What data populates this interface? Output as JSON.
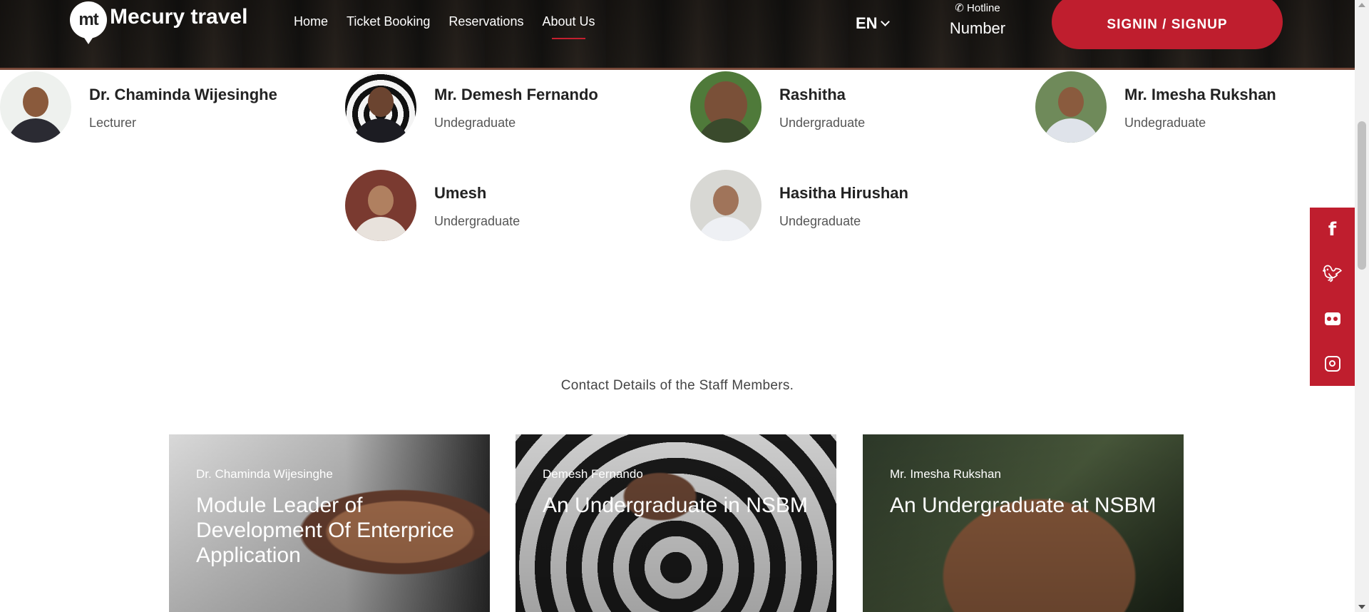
{
  "header": {
    "logo_mark": "mt",
    "logo_text": "Mecury travel",
    "nav": [
      {
        "label": "Home",
        "active": false
      },
      {
        "label": "Ticket Booking",
        "active": false
      },
      {
        "label": "Reservations",
        "active": false
      },
      {
        "label": "About Us",
        "active": true
      }
    ],
    "language": "EN",
    "hotline_icon": "phone-icon",
    "hotline_label": "Hotline",
    "hotline_number": "Number",
    "signin_label": "SIGNIN / SIGNUP",
    "accent_color": "#bf1e2e"
  },
  "team": [
    {
      "name": "Dr. Chaminda Wijesinghe",
      "role": "Lecturer"
    },
    {
      "name": "Mr. Demesh Fernando",
      "role": "Undegraduate"
    },
    {
      "name": "Rashitha",
      "role": "Undergraduate"
    },
    {
      "name": "Mr. Imesha Rukshan",
      "role": "Undegraduate"
    },
    {
      "name": "Umesh",
      "role": "Undergraduate"
    },
    {
      "name": "Hasitha Hirushan",
      "role": "Undegraduate"
    }
  ],
  "social": [
    "facebook-icon",
    "twitter-icon",
    "flickr-icon",
    "instagram-icon"
  ],
  "contact_title": "Contact Details of the Staff Members.",
  "cards": [
    {
      "name": "Dr. Chaminda Wijesinghe",
      "title": "Module Leader of Development Of Enterprice Application"
    },
    {
      "name": "Demesh Fernando",
      "title": "An Undergraduate in NSBM"
    },
    {
      "name": "Mr. Imesha Rukshan",
      "title": "An Undergraduate at NSBM"
    }
  ]
}
